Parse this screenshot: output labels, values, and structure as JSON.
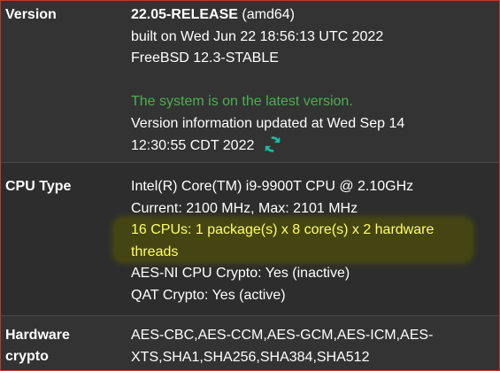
{
  "version": {
    "label": "Version",
    "release": "22.05-RELEASE",
    "arch": "(amd64)",
    "built_on": "built on Wed Jun 22 18:56:13 UTC 2022",
    "os": "FreeBSD 12.3-STABLE",
    "status": "The system is on the latest version.",
    "updated_line1": "Version information updated at Wed Sep 14",
    "updated_line2": "12:30:55 CDT 2022",
    "refresh_icon": "refresh-icon"
  },
  "cpu": {
    "label": "CPU Type",
    "model": "Intel(R) Core(TM) i9-9900T CPU @ 2.10GHz",
    "frequency": "Current: 2100 MHz, Max: 2101 MHz",
    "cores_line1": "16 CPUs: 1 package(s) x 8 core(s) x 2 hardware",
    "cores_line2": "threads",
    "aesni": "AES-NI CPU Crypto: Yes (inactive)",
    "qat": "QAT Crypto: Yes (active)"
  },
  "hardware_crypto": {
    "label_line1": "Hardware",
    "label_line2": "crypto",
    "value_line1": "AES-CBC,AES-CCM,AES-GCM,AES-ICM,AES-",
    "value_line2": "XTS,SHA1,SHA256,SHA384,SHA512"
  },
  "colors": {
    "status_green": "#4caf50",
    "highlight_text": "#ffff66",
    "refresh_icon": "#1abc9c",
    "border": "#c0392b"
  }
}
